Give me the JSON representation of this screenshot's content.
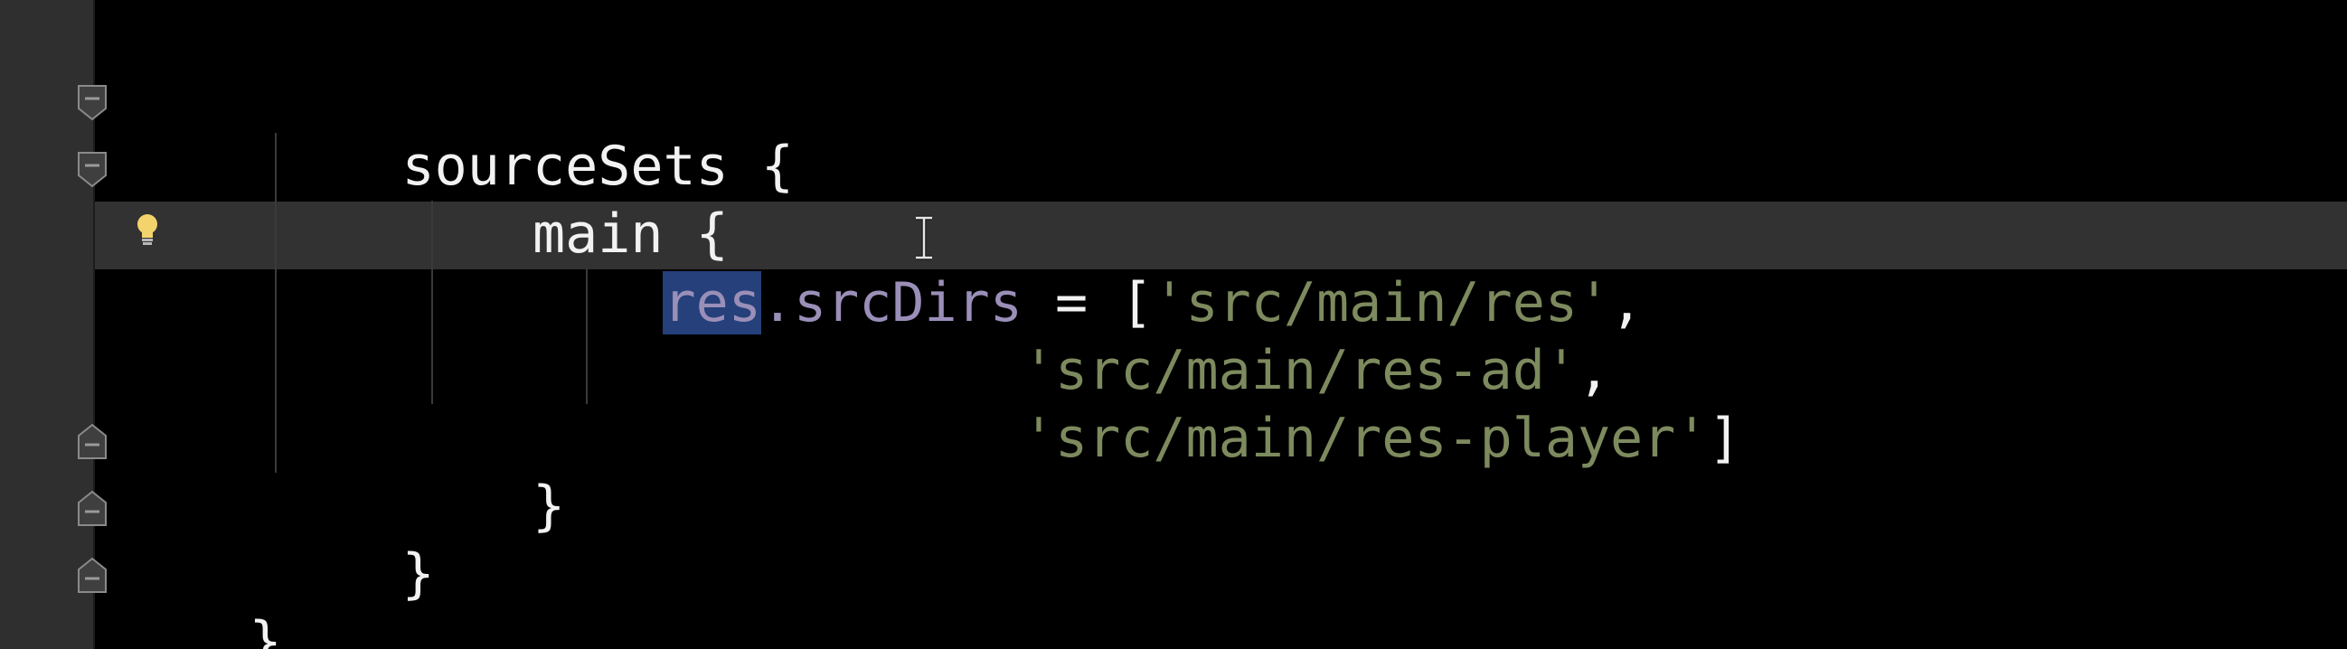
{
  "editor": {
    "lines": [
      {
        "indent": "",
        "text": "sourceSets {"
      },
      {
        "indent": "    ",
        "text": "main {"
      },
      {
        "indent": "        ",
        "selected": "res",
        "ident_rest": ".srcDirs",
        "op": " = [",
        "str1": "'src/main/res'",
        "trail": ","
      },
      {
        "indent": "                   ",
        "str": "'src/main/res-ad'",
        "trail": ","
      },
      {
        "indent": "                   ",
        "str": "'src/main/res-player'",
        "trail": "]"
      },
      {
        "indent": "    ",
        "text": "}"
      },
      {
        "indent": "",
        "text": "}"
      },
      {
        "indent": "",
        "text": "}"
      }
    ]
  },
  "icons": {
    "bulb": "lightbulb-icon",
    "fold": "fold-marker-icon",
    "caret": "text-cursor-icon"
  },
  "colors": {
    "background": "#000000",
    "gutter": "#2f2f2f",
    "current_line": "#323232",
    "selection": "#25407a",
    "identifier": "#9a8fb8",
    "string": "#7d8a5e",
    "text": "#f2f2f2"
  }
}
